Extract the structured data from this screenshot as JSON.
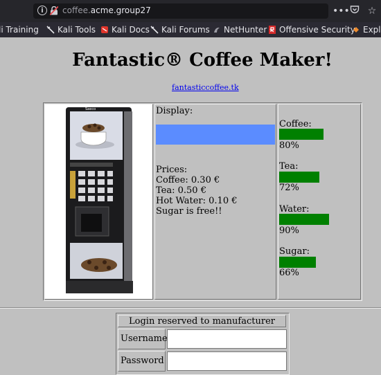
{
  "browser": {
    "url_prefix": "coffee.",
    "url_domain": "acme.group27",
    "bookmarks": [
      {
        "label": "li Training",
        "icon": "dragon-icon"
      },
      {
        "label": "Kali Tools",
        "icon": "dragon-icon"
      },
      {
        "label": "Kali Docs",
        "icon": "kali-docs-icon"
      },
      {
        "label": "Kali Forums",
        "icon": "dragon-icon"
      },
      {
        "label": "NetHunter",
        "icon": "nethunter-icon"
      },
      {
        "label": "Offensive Security",
        "icon": "offsec-icon"
      },
      {
        "label": "Expl",
        "icon": "exploit-db-icon"
      }
    ]
  },
  "page": {
    "title": "Fantastic® Coffee Maker!",
    "link": "fantasticcoffee.tk"
  },
  "display": {
    "label": "Display:",
    "bar_color": "#5b8cff"
  },
  "prices": {
    "heading": "Prices:",
    "lines": [
      "Coffee: 0.30 €",
      "Tea: 0.50 €",
      "Hot Water: 0.10 €",
      "Sugar is free!!"
    ]
  },
  "levels": [
    {
      "name": "Coffee:",
      "value": "80%",
      "fraction": 0.8
    },
    {
      "name": "Tea:",
      "value": "72%",
      "fraction": 0.72
    },
    {
      "name": "Water:",
      "value": "90%",
      "fraction": 0.9
    },
    {
      "name": "Sugar:",
      "value": "66%",
      "fraction": 0.66
    }
  ],
  "level_color": "#008000",
  "login": {
    "heading": "Login reserved to manufacturer",
    "username_label": "Username",
    "password_label": "Password",
    "username_value": "",
    "password_value": ""
  }
}
